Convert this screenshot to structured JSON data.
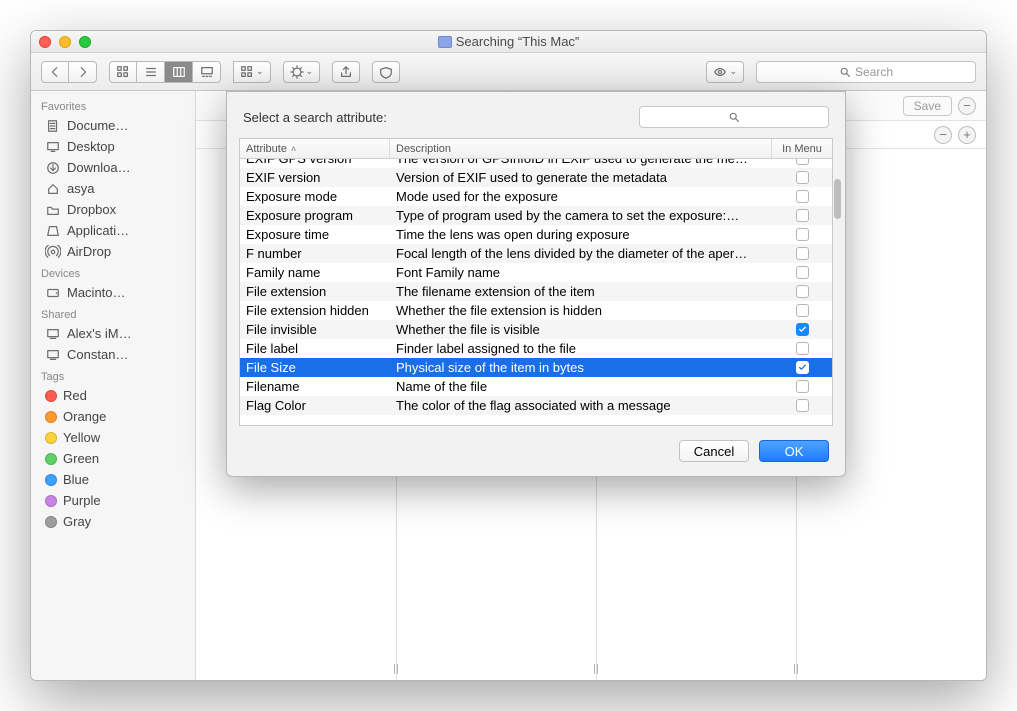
{
  "window": {
    "title": "Searching “This Mac”"
  },
  "toolbar": {
    "search_placeholder": "Search",
    "save_label": "Save"
  },
  "sidebar": {
    "sections": [
      {
        "title": "Favorites",
        "items": [
          {
            "label": "Docume…",
            "icon": "document-icon"
          },
          {
            "label": "Desktop",
            "icon": "desktop-icon"
          },
          {
            "label": "Downloa…",
            "icon": "downloads-icon"
          },
          {
            "label": "asya",
            "icon": "home-icon"
          },
          {
            "label": "Dropbox",
            "icon": "folder-icon"
          },
          {
            "label": "Applicati…",
            "icon": "applications-icon"
          },
          {
            "label": "AirDrop",
            "icon": "airdrop-icon"
          }
        ]
      },
      {
        "title": "Devices",
        "items": [
          {
            "label": "Macinto…",
            "icon": "disk-icon"
          }
        ]
      },
      {
        "title": "Shared",
        "items": [
          {
            "label": "Alex's iM…",
            "icon": "monitor-icon"
          },
          {
            "label": "Constan…",
            "icon": "monitor-icon"
          }
        ]
      },
      {
        "title": "Tags",
        "items": [
          {
            "label": "Red",
            "color": "#ff5b51"
          },
          {
            "label": "Orange",
            "color": "#ff9a2f"
          },
          {
            "label": "Yellow",
            "color": "#ffd23a"
          },
          {
            "label": "Green",
            "color": "#5dd166"
          },
          {
            "label": "Blue",
            "color": "#3aa2ff"
          },
          {
            "label": "Purple",
            "color": "#c983e5"
          },
          {
            "label": "Gray",
            "color": "#9d9d9d"
          }
        ]
      }
    ]
  },
  "sheet": {
    "prompt": "Select a search attribute:",
    "columns": {
      "attr": "Attribute",
      "desc": "Description",
      "menu": "In Menu"
    },
    "cancel": "Cancel",
    "ok": "OK",
    "selected_index": 10,
    "rows": [
      {
        "attr": "EXIF GPS version",
        "desc": "The version of GPSInfoID in EXIF used to generate the me…",
        "checked": false,
        "clipped": true
      },
      {
        "attr": "EXIF version",
        "desc": "Version of EXIF used to generate the metadata",
        "checked": false
      },
      {
        "attr": "Exposure mode",
        "desc": "Mode used for the exposure",
        "checked": false
      },
      {
        "attr": "Exposure program",
        "desc": "Type of program used by the camera to set the exposure:…",
        "checked": false
      },
      {
        "attr": "Exposure time",
        "desc": "Time the lens was open during exposure",
        "checked": false
      },
      {
        "attr": "F number",
        "desc": "Focal length of the lens divided by the diameter of the aper…",
        "checked": false
      },
      {
        "attr": "Family name",
        "desc": "Font Family name",
        "checked": false
      },
      {
        "attr": "File extension",
        "desc": "The filename extension of the item",
        "checked": false
      },
      {
        "attr": "File extension hidden",
        "desc": "Whether the file extension is hidden",
        "checked": false
      },
      {
        "attr": "File invisible",
        "desc": "Whether the file is visible",
        "checked": true
      },
      {
        "attr": "File label",
        "desc": "Finder label assigned to the file",
        "checked": false
      },
      {
        "attr": "File Size",
        "desc": "Physical size of the item in bytes",
        "checked": true
      },
      {
        "attr": "Filename",
        "desc": "Name of the file",
        "checked": false
      },
      {
        "attr": "Flag Color",
        "desc": "The color of the flag associated with a message",
        "checked": false
      }
    ]
  }
}
